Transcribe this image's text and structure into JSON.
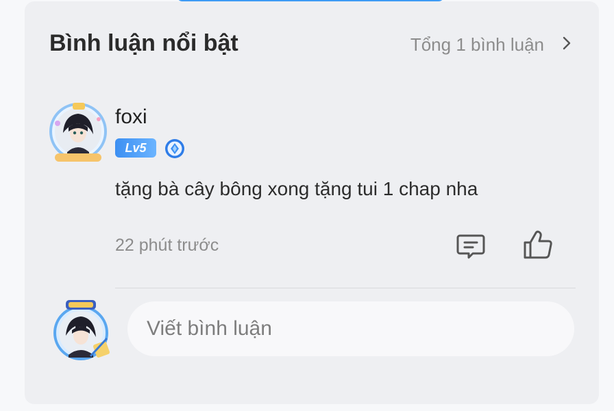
{
  "header": {
    "title": "Bình luận nổi bật",
    "total_label": "Tổng 1 bình luận"
  },
  "comment": {
    "username": "foxi",
    "level": "Lv5",
    "text": "tặng bà cây bông xong tặng tui 1 chap nha",
    "time": "22 phút trước",
    "avatar_icon": "anime-avatar-icon",
    "rank_icon": "diamond-rank-icon"
  },
  "composer": {
    "placeholder": "Viết bình luận",
    "avatar_icon": "writer-avatar-icon"
  },
  "colors": {
    "accent": "#3d9bf5",
    "card_bg": "#eeeff2",
    "muted_text": "#8c8c8c"
  }
}
